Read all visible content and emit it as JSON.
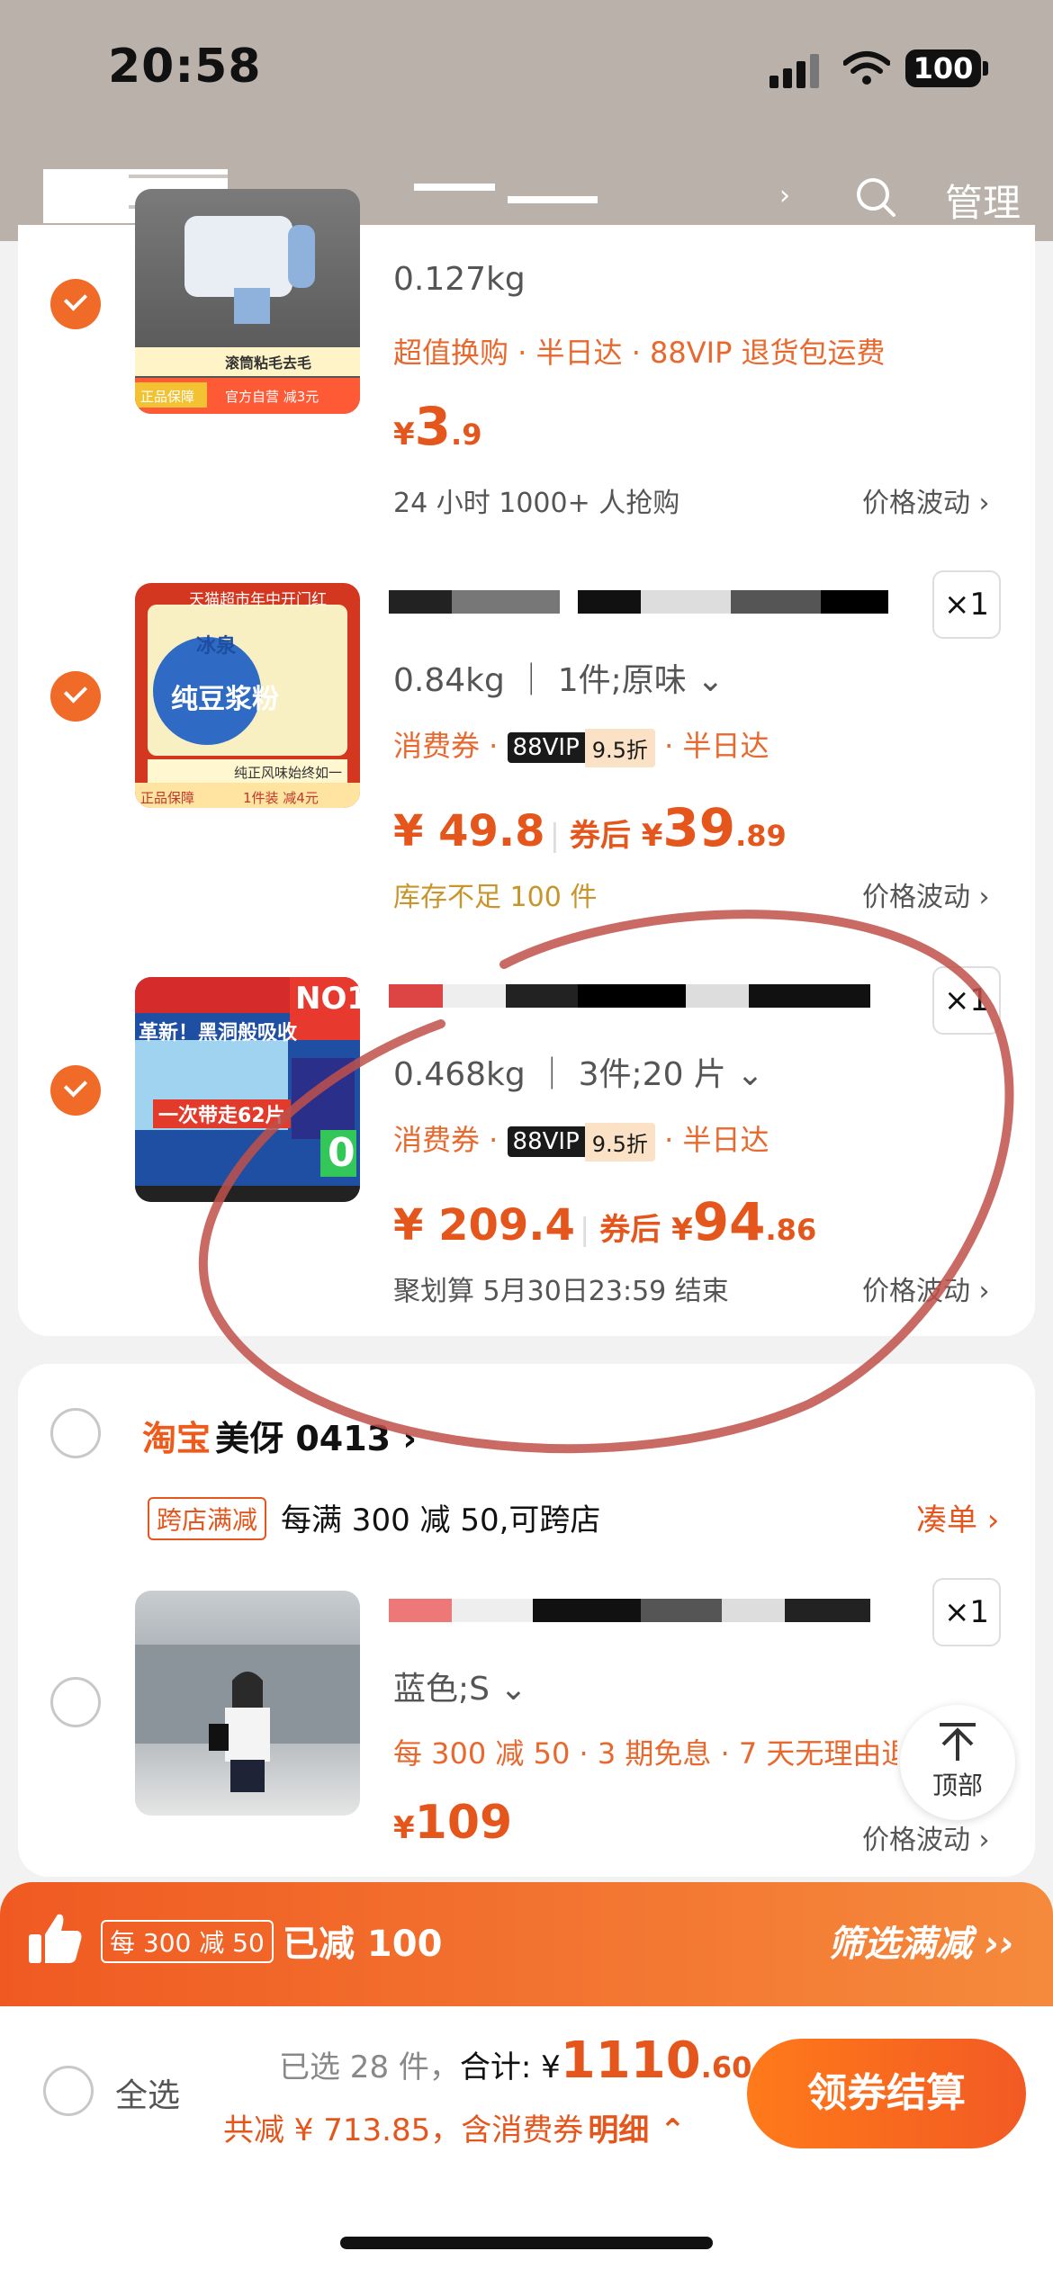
{
  "status_bar": {
    "time": "20:58",
    "battery": "100"
  },
  "header": {
    "manage": "管理"
  },
  "items": [
    {
      "weight": "0.127kg",
      "tags": "超值换购 · 半日达 · 88VIP 退货包运费",
      "price_symbol": "¥",
      "price_int": "3",
      "price_dec": ".9",
      "note": "24 小时 1000+ 人抢购",
      "price_wave": "价格波动 ›",
      "thumb": {
        "badge1": "正品保障",
        "badge2": "官方自营 减3元",
        "caption": "滚筒粘毛去毛"
      }
    },
    {
      "qty": "×1",
      "spec": "0.84kg ｜ 1件;原味 ⌄",
      "tag1": "消费券 ·",
      "vip": "88VIP",
      "vip_discount": "9.5折",
      "tag2": "· 半日达",
      "price": "¥ 49.8",
      "coupon_label": "券后 ¥",
      "coupon_int": "39",
      "coupon_dec": ".89",
      "stock_note": "库存不足 100 件",
      "price_wave": "价格波动 ›",
      "thumb": {
        "top": "天猫超市年中开门红",
        "brand": "冰泉",
        "name": "纯豆浆粉",
        "bottom": "纯正风味始终如一",
        "badge": "正品保障",
        "deal": "1件装 减4元"
      }
    },
    {
      "qty": "×1",
      "spec": "0.468kg ｜ 3件;20 片 ⌄",
      "tag1": "消费券 ·",
      "vip": "88VIP",
      "vip_discount": "9.5折",
      "tag2": "· 半日达",
      "price": "¥ 209.4",
      "coupon_label": "券后 ¥",
      "coupon_int": "94",
      "coupon_dec": ".86",
      "deadline": "聚划算 5月30日23:59 结束",
      "price_wave": "价格波动 ›",
      "thumb": {
        "no1": "NO1",
        "headline": "革新！黑洞般吸收",
        "banner": "一次带走62片",
        "zero": "0"
      }
    }
  ],
  "shop": {
    "platform": "淘宝",
    "name": "美伢 0413 ›",
    "promo_tag": "跨店满减",
    "promo_text": "每满 300 减 50,可跨店",
    "coudan": "凑单 ›",
    "item": {
      "qty": "×1",
      "spec": "蓝色;S ⌄",
      "tags": "每 300 减 50 · 3 期免息 · 7 天无理由退",
      "price_symbol": "¥",
      "price": "109",
      "price_wave": "价格波动 ›"
    }
  },
  "to_top": "顶部",
  "promo_bar": {
    "tag": "每 300 减 50",
    "reduced": "已减 100",
    "filter": "筛选满减 ››"
  },
  "bottom": {
    "select_all": "全选",
    "selected": "已选 28 件，",
    "total_label": "合计: ¥",
    "total_int": "1110",
    "total_dec": ".60",
    "saved": "共减 ¥ 713.85，含消费券",
    "detail": "明细 ⌃",
    "checkout": "领券结算"
  },
  "colors": {
    "accent": "#f06a28",
    "price": "#e5561d",
    "header_bg": "#b9b1aa",
    "annotation": "#c0504a"
  }
}
